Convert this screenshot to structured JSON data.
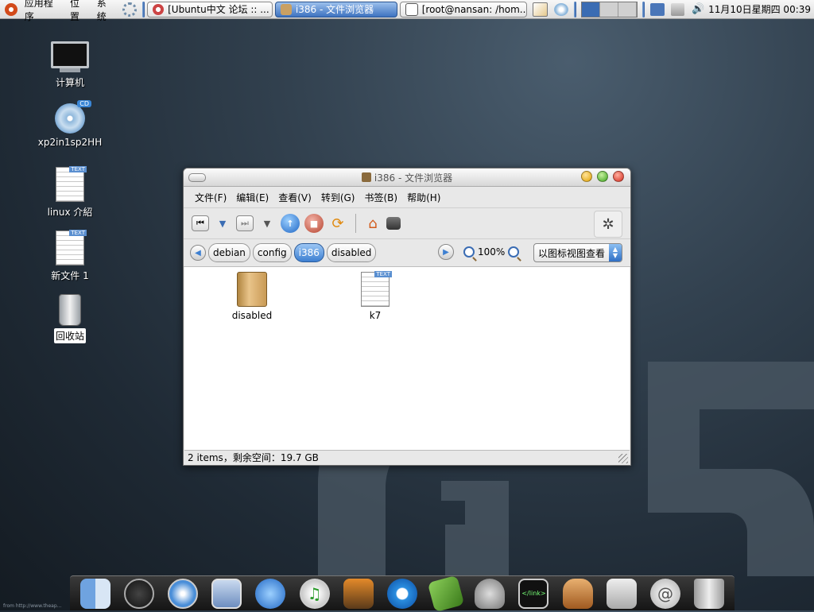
{
  "top_panel": {
    "menu": [
      "应用程序",
      "位置",
      "系统"
    ],
    "tasks": [
      {
        "label": "[Ubuntu中文 论坛 :: ...",
        "active": false
      },
      {
        "label": "i386 - 文件浏览器",
        "active": true
      },
      {
        "label": "[root@nansan: /hom...",
        "active": false
      }
    ],
    "clock": "11月10日星期四 00:39"
  },
  "desktop": {
    "icons": [
      {
        "label": "计算机"
      },
      {
        "label": "xp2in1sp2HH"
      },
      {
        "label": "linux 介紹"
      },
      {
        "label": "新文件 1"
      },
      {
        "label": "回收站"
      }
    ],
    "watermark": "G5",
    "credit": "from http://www.theap..."
  },
  "window": {
    "title": "i386 - 文件浏览器",
    "menu": [
      "文件(F)",
      "编辑(E)",
      "查看(V)",
      "转到(G)",
      "书签(B)",
      "帮助(H)"
    ],
    "breadcrumbs": [
      "debian",
      "config",
      "i386",
      "disabled"
    ],
    "current_crumb": "i386",
    "zoom": "100%",
    "view_mode": "以图标视图查看",
    "files": [
      {
        "name": "disabled",
        "type": "folder"
      },
      {
        "name": "k7",
        "type": "text"
      }
    ],
    "status": "2 items，剩余空间：19.7 GB"
  },
  "dock": [
    "finder",
    "dashboard",
    "safari",
    "mail",
    "ichat",
    "itunes",
    "iphoto",
    "quicktime",
    "dictionary",
    "automator",
    "html-editor",
    "downloader",
    "system-prefs",
    "address",
    "trash"
  ]
}
